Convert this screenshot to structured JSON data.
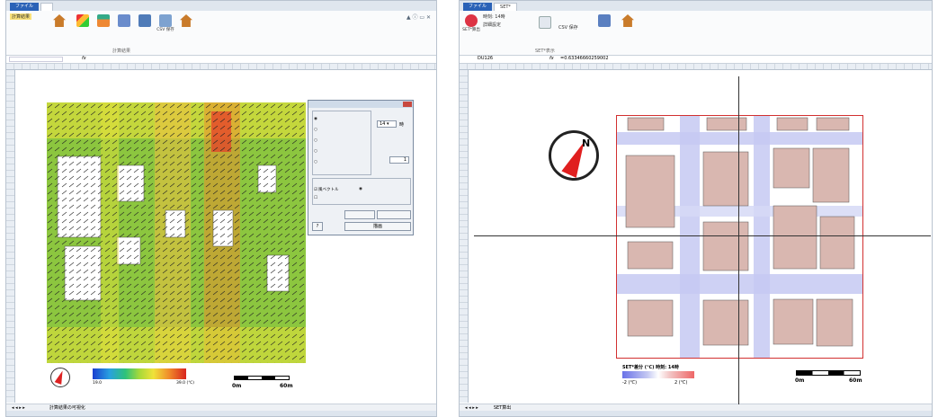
{
  "left": {
    "tabs": [
      "ファイル"
    ],
    "ribbon": {
      "calc_result_label": "計算結果",
      "buttons": [
        "",
        "",
        "",
        "",
        "",
        "CSV\n保存",
        ""
      ],
      "groups": [
        "",
        "計算結果"
      ]
    },
    "dialog": {
      "title": "",
      "section1_options": [
        "",
        "",
        "",
        "",
        ""
      ],
      "selected_option_index": 0,
      "time_label": "",
      "time_value": "14",
      "time_unit": "時",
      "draw_height_label": "",
      "draw_height_value": "1",
      "display_options_label": "",
      "wind_vector": "風ベクトル",
      "building_road": "",
      "cross_section": "",
      "btn_vector_settings": "",
      "btn_draw": "描画",
      "btn_help": "?"
    },
    "legend": {
      "min": "19.0",
      "max": "39.0 (℃)"
    },
    "scale": {
      "start": "0m",
      "end": "60m"
    },
    "sheets": [
      "",
      "",
      "計算結果の可視化"
    ]
  },
  "right": {
    "tabs": [
      "ファイル",
      "SET*"
    ],
    "ribbon": {
      "time_label": "時刻: 14時",
      "detail_settings": "詳細設定",
      "building_display": "",
      "draw_condition": "",
      "range_label": "SET*表示",
      "csv_save": "CSV 保存",
      "diff_label": "",
      "save": "",
      "set_button": "SET*算出"
    },
    "formula_bar": {
      "cell": "DU126",
      "formula": "=0.63346660259002"
    },
    "legend": {
      "title": "SET*差分 (℃) 時刻: 14時",
      "min": "-2 (℃)",
      "max": "2 (℃)"
    },
    "scale": {
      "start": "0m",
      "end": "60m"
    },
    "sheets": [
      "",
      "SET算出"
    ]
  },
  "colors": {
    "excel_blue": "#2a62b7",
    "frame_red": "#d23030",
    "building_pink": "#d9b7b0",
    "cool_blue": "#c5c9f2"
  }
}
